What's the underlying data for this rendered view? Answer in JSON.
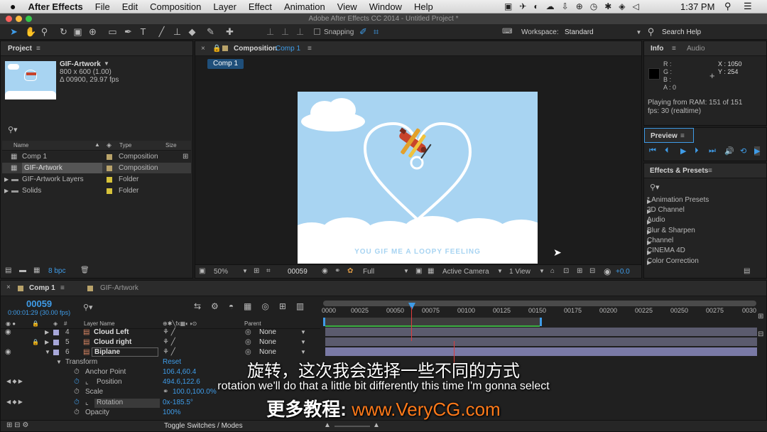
{
  "menubar": {
    "items": [
      "After Effects",
      "File",
      "Edit",
      "Composition",
      "Layer",
      "Effect",
      "Animation",
      "View",
      "Window",
      "Help"
    ],
    "time": "1:37 PM"
  },
  "window": {
    "title": "Adobe After Effects CC 2014 - Untitled Project *"
  },
  "toolbar": {
    "snapping": "Snapping",
    "workspace_label": "Workspace:",
    "workspace_value": "Standard",
    "search_help": "Search Help"
  },
  "project": {
    "title": "Project",
    "item_name": "GIF-Artwork",
    "item_dims": "800 x 600 (1.00)",
    "item_duration": "Δ 00900, 29.97 fps",
    "columns": {
      "name": "Name",
      "type": "Type",
      "size": "Size"
    },
    "items": [
      {
        "name": "Comp 1",
        "type": "Composition",
        "color": "#b9a36a"
      },
      {
        "name": "GIF-Artwork",
        "type": "Composition",
        "color": "#b9a36a"
      },
      {
        "name": "GIF-Artwork Layers",
        "type": "Folder",
        "color": "#d6c23a"
      },
      {
        "name": "Solids",
        "type": "Folder",
        "color": "#d6c23a"
      }
    ],
    "bpc": "8 bpc"
  },
  "composition": {
    "title": "Composition",
    "title_comp": "Comp 1",
    "tab": "Comp 1",
    "art_text": "YOU GIF ME A LOOPY FEELING",
    "footer": {
      "zoom": "50%",
      "timecode": "00059",
      "resolution": "Full",
      "camera": "Active Camera",
      "views": "1 View",
      "exposure": "+0.0"
    }
  },
  "info": {
    "tab_info": "Info",
    "tab_audio": "Audio",
    "r": "R :",
    "g": "G :",
    "b": "B :",
    "a": "A : 0",
    "x": "X : 1050",
    "y": "Y : 254",
    "status1": "Playing from RAM: 151 of 151",
    "status2": "fps: 30 (realtime)"
  },
  "preview": {
    "title": "Preview"
  },
  "effects": {
    "title": "Effects & Presets",
    "items": [
      "* Animation Presets",
      "3D Channel",
      "Audio",
      "Blur & Sharpen",
      "Channel",
      "CINEMA 4D",
      "Color Correction"
    ]
  },
  "timeline": {
    "tab1": "Comp 1",
    "tab2": "GIF-Artwork",
    "timecode": "00059",
    "timecode_sub": "0:00:01:29 (30.00 fps)",
    "col_num": "#",
    "col_layer": "Layer Name",
    "col_parent": "Parent",
    "ruler": [
      "0000",
      "00025",
      "00050",
      "00075",
      "00100",
      "00125",
      "00150",
      "00175",
      "00200",
      "00225",
      "00250",
      "00275",
      "0030"
    ],
    "layers": [
      {
        "num": "4",
        "name": "Cloud Left",
        "parent": "None"
      },
      {
        "num": "5",
        "name": "Cloud right",
        "parent": "None"
      },
      {
        "num": "6",
        "name": "Biplane",
        "parent": "None"
      }
    ],
    "transform": "Transform",
    "reset": "Reset",
    "props": [
      {
        "name": "Anchor Point",
        "value": "106.4,60.4"
      },
      {
        "name": "Position",
        "value": "494.6,122.6"
      },
      {
        "name": "Scale",
        "value": "100.0,100.0%"
      },
      {
        "name": "Rotation",
        "value": "0x-185.5°"
      },
      {
        "name": "Opacity",
        "value": "100%"
      }
    ],
    "toggle": "Toggle Switches / Modes"
  },
  "subtitles": {
    "line_cn": "旋转，这次我会选择一些不同的方式",
    "line_en": "rotation we'll do that a little bit differently this time I'm gonna select",
    "watermark_cn": "更多教程:",
    "watermark_url": "www.VeryCG.com"
  },
  "colors": {
    "accent": "#3f9ce8",
    "sky": "#a8d4f2",
    "watermark": "#ff7a1a"
  }
}
